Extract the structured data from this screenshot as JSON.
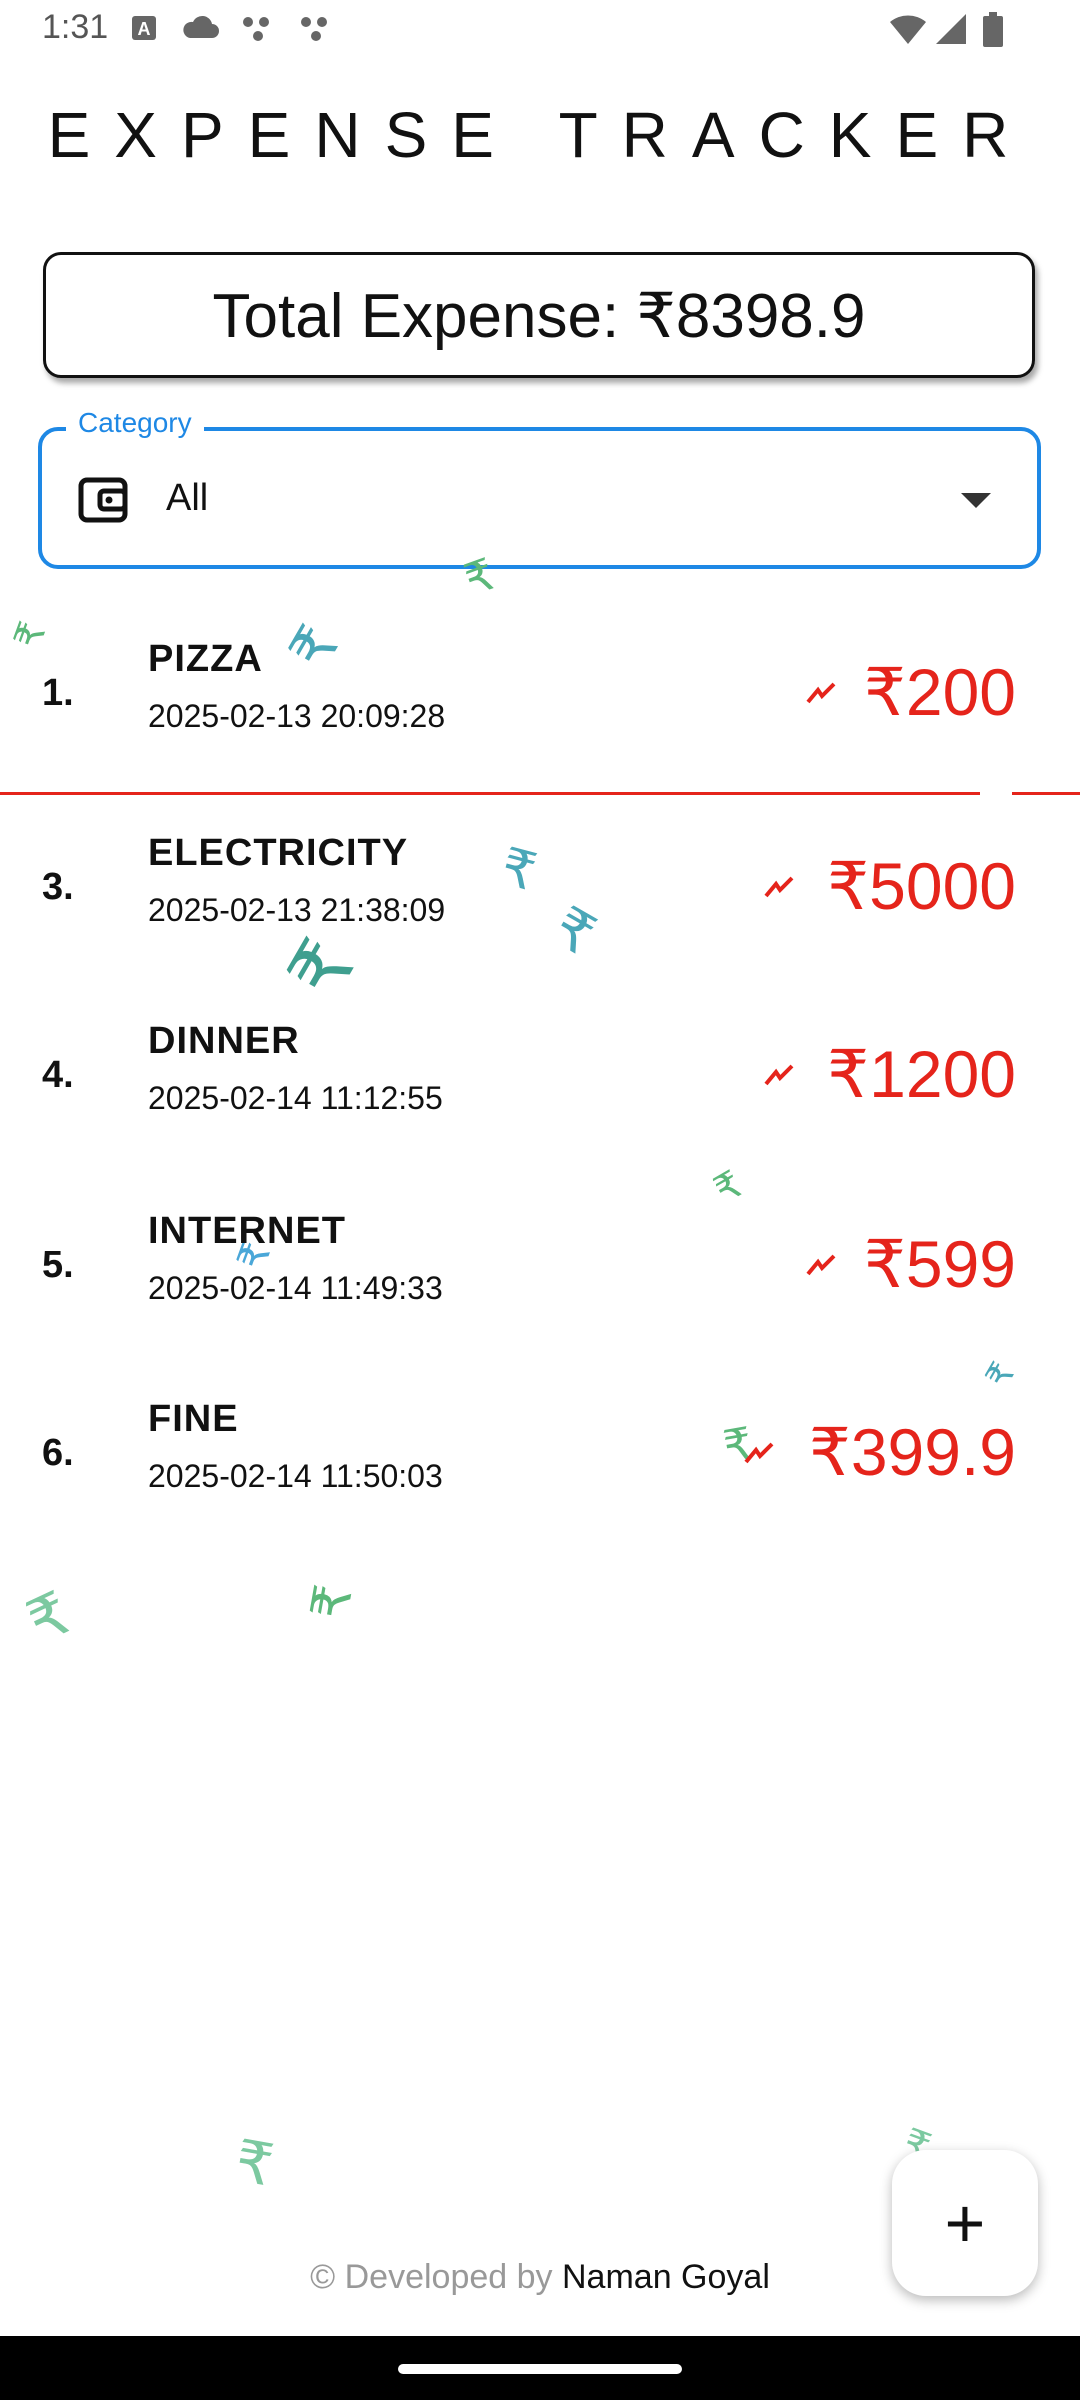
{
  "status_bar": {
    "time": "1:31",
    "left_icons": [
      "a-notification-icon",
      "cloud-icon",
      "assistant-dots-icon",
      "assistant-dots-icon"
    ],
    "right_icons": [
      "wifi-icon",
      "signal-icon",
      "battery-icon"
    ]
  },
  "app": {
    "title": "EXPENSE TRACKER"
  },
  "total": {
    "label": "Total Expense: ₹8398.9"
  },
  "category": {
    "label": "Category",
    "selected": "All",
    "icon": "wallet-icon"
  },
  "expenses": [
    {
      "index": "1.",
      "name": "PIZZA",
      "date": "2025-02-13 20:09:28",
      "amount": "₹200"
    },
    {
      "index": "3.",
      "name": "ELECTRICITY",
      "date": "2025-02-13 21:38:09",
      "amount": "₹5000"
    },
    {
      "index": "4.",
      "name": "DINNER",
      "date": "2025-02-14 11:12:55",
      "amount": "₹1200"
    },
    {
      "index": "5.",
      "name": "INTERNET",
      "date": "2025-02-14 11:49:33",
      "amount": "₹599"
    },
    {
      "index": "6.",
      "name": "FINE",
      "date": "2025-02-14 11:50:03",
      "amount": "₹399.9"
    }
  ],
  "fab": {
    "label": "+"
  },
  "footer": {
    "prefix": "© Developed by",
    "author": "Naman Goyal"
  },
  "colors": {
    "accent": "#1e88e5",
    "amount": "#e5241b",
    "rupee_teal": "#4aa7b8",
    "rupee_green": "#5cb87a"
  }
}
